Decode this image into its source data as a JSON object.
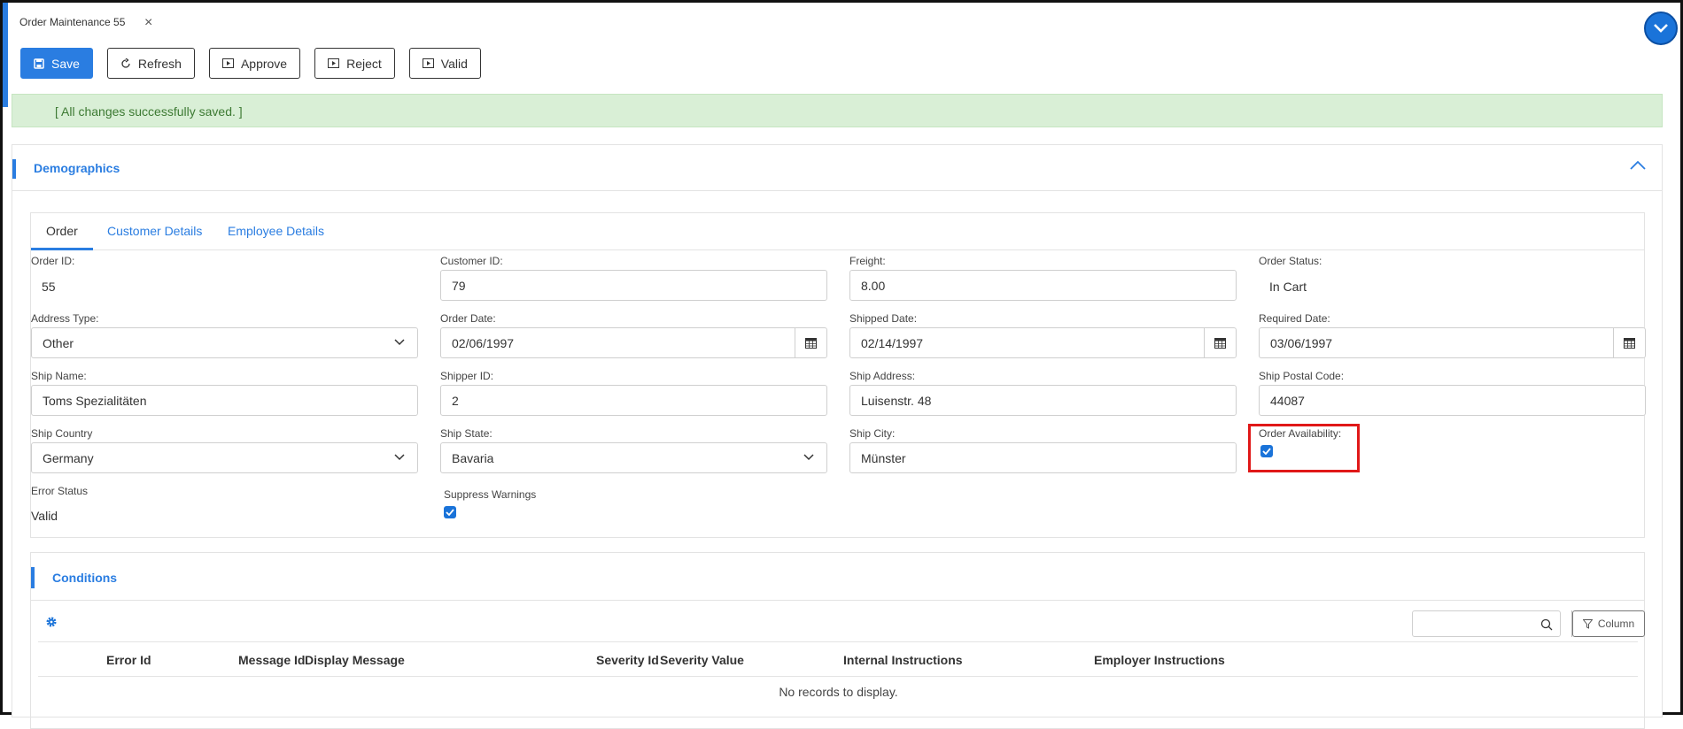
{
  "window": {
    "tab_title": "Order Maintenance 55"
  },
  "toolbar": {
    "save": "Save",
    "refresh": "Refresh",
    "approve": "Approve",
    "reject": "Reject",
    "valid": "Valid"
  },
  "message": "[ All changes successfully saved. ]",
  "section": {
    "title": "Demographics"
  },
  "tabs": [
    "Order",
    "Customer Details",
    "Employee Details"
  ],
  "fields": {
    "order_id": {
      "label": "Order ID:",
      "value": "55"
    },
    "customer_id": {
      "label": "Customer ID:",
      "value": "79"
    },
    "freight": {
      "label": "Freight:",
      "value": "8.00"
    },
    "order_status": {
      "label": "Order Status:",
      "value": "In Cart"
    },
    "address_type": {
      "label": "Address Type:",
      "value": "Other"
    },
    "order_date": {
      "label": "Order Date:",
      "value": "02/06/1997"
    },
    "shipped_date": {
      "label": "Shipped Date:",
      "value": "02/14/1997"
    },
    "required_date": {
      "label": "Required Date:",
      "value": "03/06/1997"
    },
    "ship_name": {
      "label": "Ship Name:",
      "value": "Toms Spezialitäten"
    },
    "shipper_id": {
      "label": "Shipper ID:",
      "value": "2"
    },
    "ship_address": {
      "label": "Ship Address:",
      "value": "Luisenstr. 48"
    },
    "ship_postal_code": {
      "label": "Ship Postal Code:",
      "value": "44087"
    },
    "ship_country": {
      "label": "Ship Country",
      "value": "Germany"
    },
    "ship_state": {
      "label": "Ship State:",
      "value": "Bavaria"
    },
    "ship_city": {
      "label": "Ship City:",
      "value": "Münster"
    },
    "order_availability": {
      "label": "Order Availability:",
      "checked": true
    },
    "error_status": {
      "label": "Error Status",
      "value": "Valid"
    },
    "suppress_warnings": {
      "label": "Suppress Warnings",
      "checked": true
    }
  },
  "conditions": {
    "title": "Conditions",
    "column_button": "Column",
    "columns": [
      "Error Id",
      "Message Id",
      "Display Message",
      "Severity Id",
      "Severity Value",
      "Internal Instructions",
      "Employer Instructions"
    ],
    "empty_text": "No records to display."
  },
  "colors": {
    "accent": "#2a7de1",
    "success_bg": "#d9efd6",
    "success_text": "#3d7a33",
    "highlight": "#e01818"
  }
}
